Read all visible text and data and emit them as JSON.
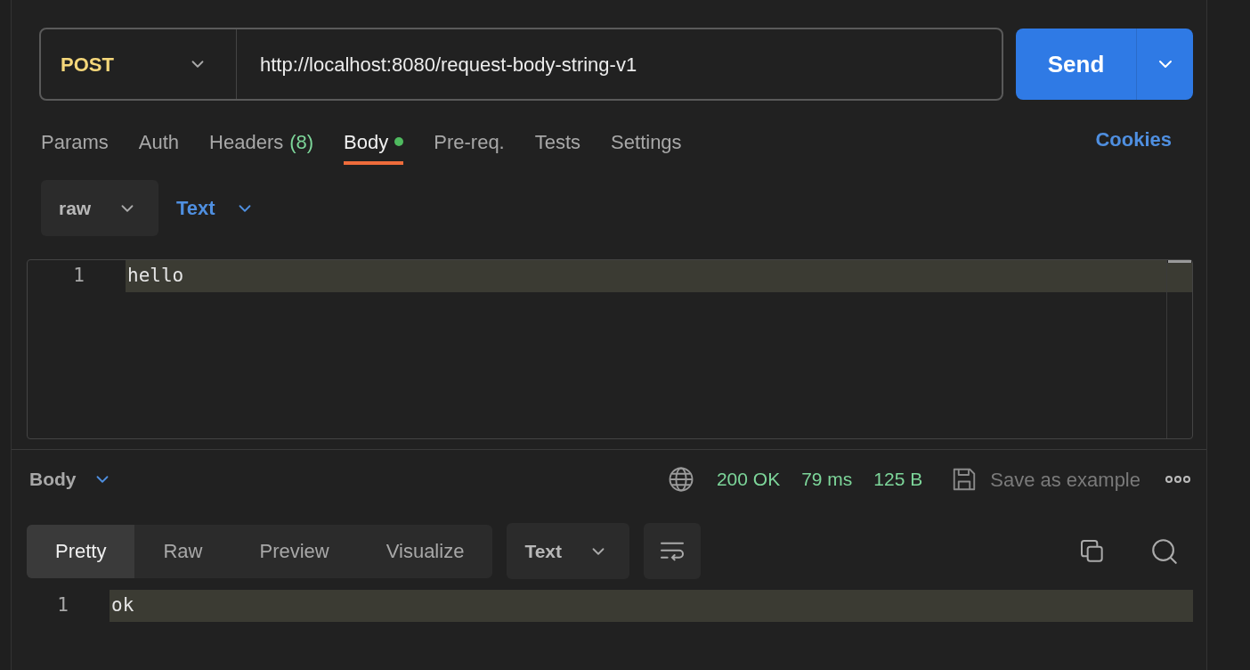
{
  "request": {
    "method": "POST",
    "url": "http://localhost:8080/request-body-string-v1",
    "send_label": "Send"
  },
  "tabs": [
    {
      "label": "Params",
      "selected": false,
      "modified": false
    },
    {
      "label": "Auth",
      "selected": false,
      "modified": false
    },
    {
      "label": "Headers",
      "count": "(8)",
      "selected": false,
      "modified": false
    },
    {
      "label": "Body",
      "selected": true,
      "modified": true
    },
    {
      "label": "Pre-req.",
      "selected": false,
      "modified": false
    },
    {
      "label": "Tests",
      "selected": false,
      "modified": false
    },
    {
      "label": "Settings",
      "selected": false,
      "modified": false
    }
  ],
  "cookies_link": "Cookies",
  "body_options": {
    "mode": "raw",
    "language": "Text"
  },
  "request_editor": {
    "lines": [
      {
        "number": "1",
        "text": "hello",
        "current": true
      }
    ]
  },
  "response": {
    "section_label": "Body",
    "status": "200 OK",
    "time": "79 ms",
    "size": "125 B",
    "save_label": "Save as example",
    "view_tabs": [
      {
        "label": "Pretty",
        "selected": true
      },
      {
        "label": "Raw",
        "selected": false
      },
      {
        "label": "Preview",
        "selected": false
      },
      {
        "label": "Visualize",
        "selected": false
      }
    ],
    "format": "Text",
    "lines": [
      {
        "number": "1",
        "text": "ok",
        "current": true
      }
    ]
  }
}
